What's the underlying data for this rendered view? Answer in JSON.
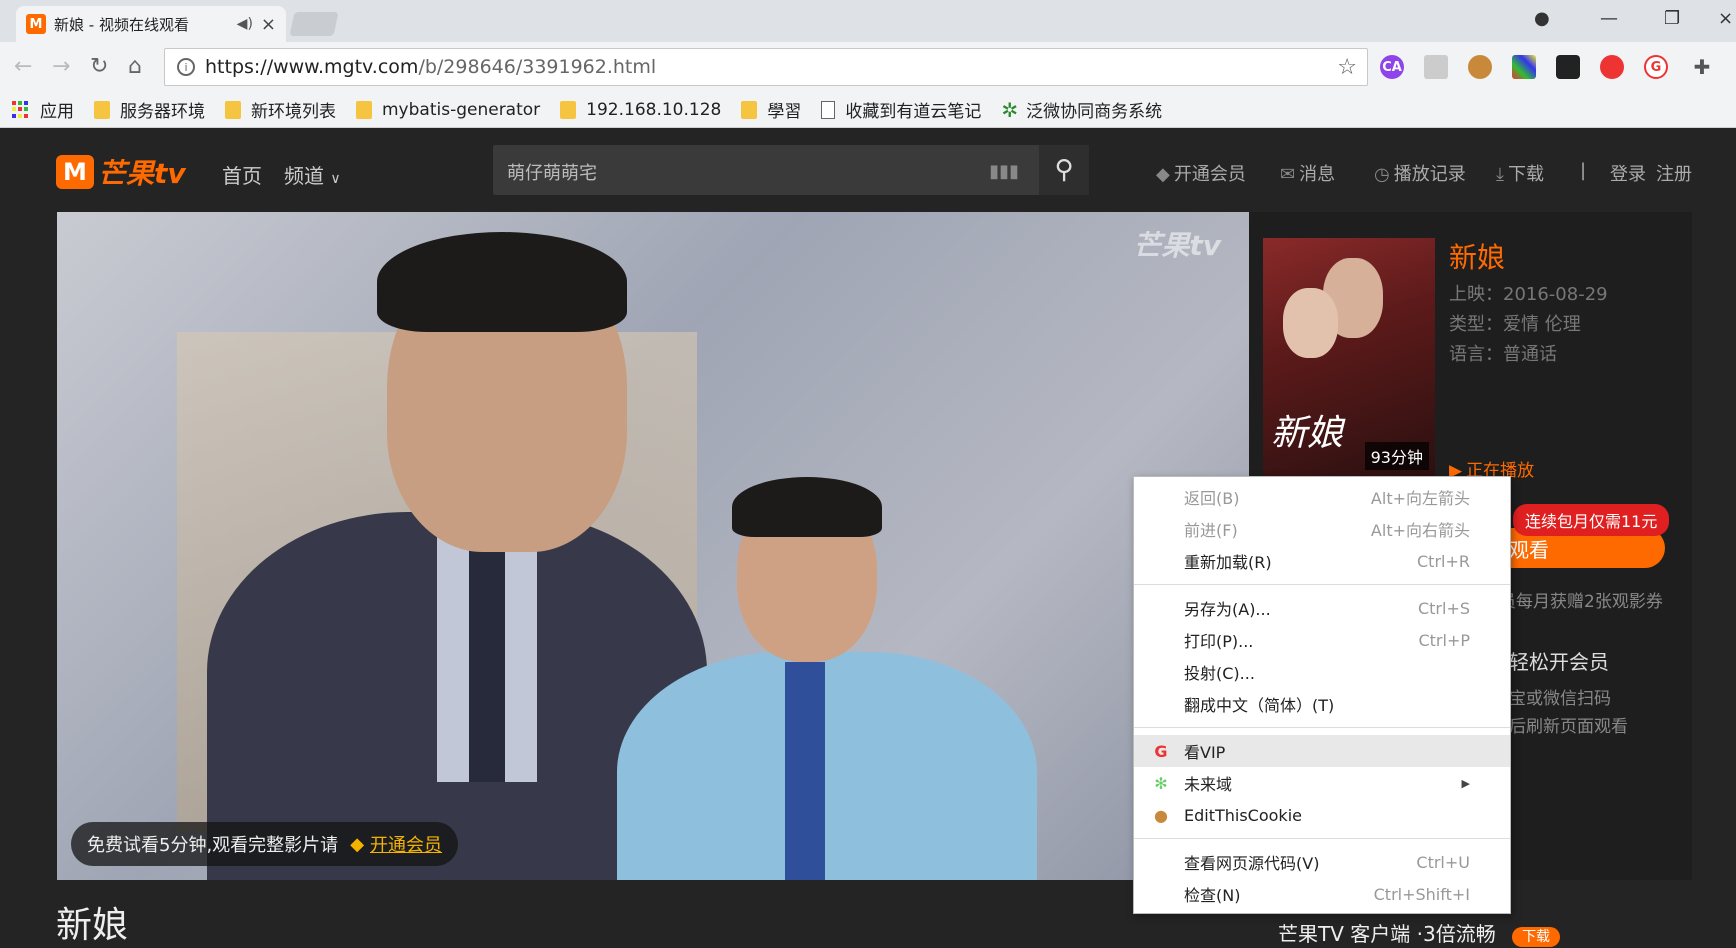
{
  "browser": {
    "tab_title": "新娘 - 视频在线观看",
    "favicon_letter": "M",
    "url_host": "https://www.mgtv.com",
    "url_path": "/b/298646/3391962.html",
    "bookmarks": [
      {
        "label": "应用",
        "type": "apps"
      },
      {
        "label": "服务器环境",
        "type": "folder"
      },
      {
        "label": "新环境列表",
        "type": "folder"
      },
      {
        "label": "mybatis-generator",
        "type": "folder"
      },
      {
        "label": "192.168.10.128",
        "type": "folder"
      },
      {
        "label": "學習",
        "type": "folder"
      },
      {
        "label": "收藏到有道云笔记",
        "type": "doc"
      },
      {
        "label": "泛微协同商务系统",
        "type": "gear"
      }
    ]
  },
  "site": {
    "logo_text": "芒果tv",
    "nav": [
      "首页",
      "频道"
    ],
    "search_placeholder": "萌仔萌萌宅",
    "header_links": [
      "开通会员",
      "消息",
      "播放记录",
      "下载",
      "登录",
      "注册"
    ],
    "divider": "|"
  },
  "player": {
    "watermark": "芒果tv",
    "trial_text": "免费试看5分钟,观看完整影片请",
    "trial_link": "开通会员"
  },
  "info": {
    "title": "新娘",
    "release": "上映：2016-08-29",
    "genre": "类型：爱情 伦理",
    "language": "语言：普通话",
    "duration": "93分钟",
    "poster_title": "新娘",
    "now_playing": "正在播放",
    "promo_tag": "连续包月仅需11元",
    "watch_label": "观看",
    "vip_perk": "员每月获赠2张观影券",
    "easy_vip": "轻松开会员",
    "qr_line1": "宝或微信扫码",
    "qr_line2": "后刷新页面观看"
  },
  "page": {
    "title": "新娘",
    "app_promo": "芒果TV  客户端  ·3倍流畅",
    "download_badge": "下载"
  },
  "context_menu": {
    "items": [
      {
        "label": "返回(B)",
        "shortcut": "Alt+向左箭头",
        "disabled": true
      },
      {
        "label": "前进(F)",
        "shortcut": "Alt+向右箭头",
        "disabled": true
      },
      {
        "label": "重新加载(R)",
        "shortcut": "Ctrl+R"
      },
      {
        "label": "另存为(A)...",
        "shortcut": "Ctrl+S"
      },
      {
        "label": "打印(P)...",
        "shortcut": "Ctrl+P"
      },
      {
        "label": "投射(C)...",
        "shortcut": ""
      },
      {
        "label": "翻成中文（简体）(T)",
        "shortcut": ""
      },
      {
        "label": "看VIP",
        "icon": "vip-extension-icon"
      },
      {
        "label": "未来域",
        "icon": "weilaiyu-extension-icon",
        "submenu": true
      },
      {
        "label": "EditThisCookie",
        "icon": "cookie-icon"
      },
      {
        "label": "查看网页源代码(V)",
        "shortcut": "Ctrl+U"
      },
      {
        "label": "检查(N)",
        "shortcut": "Ctrl+Shift+I"
      }
    ]
  },
  "colors": {
    "brand_orange": "#ff6a00",
    "promo_red": "#e02020",
    "vip_gold": "#f5b300"
  }
}
